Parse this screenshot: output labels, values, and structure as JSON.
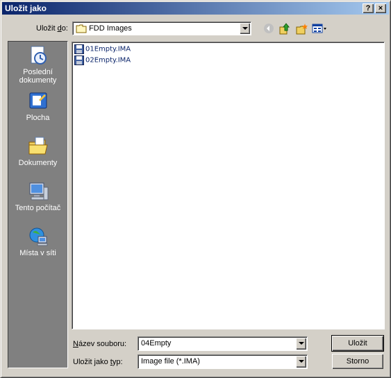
{
  "window": {
    "title": "Uložit jako"
  },
  "titlebar_buttons": {
    "help": "?",
    "close": "×"
  },
  "toolbar": {
    "save_in_label_pre": "Uložit ",
    "save_in_label_key": "d",
    "save_in_label_post": "o:",
    "current_folder": "FDD Images",
    "icons": [
      "back-icon",
      "up-folder-icon",
      "new-folder-icon",
      "view-menu-icon"
    ]
  },
  "places": [
    {
      "label": "Poslední dokumenty",
      "icon": "recent-documents-icon"
    },
    {
      "label": "Plocha",
      "icon": "desktop-icon"
    },
    {
      "label": "Dokumenty",
      "icon": "documents-icon"
    },
    {
      "label": "Tento počítač",
      "icon": "my-computer-icon"
    },
    {
      "label": "Místa v síti",
      "icon": "network-places-icon"
    }
  ],
  "files": [
    {
      "name": "01Empty.IMA"
    },
    {
      "name": "02Empty.IMA"
    }
  ],
  "filename": {
    "label_key": "N",
    "label_rest": "ázev souboru:",
    "value": "04Empty"
  },
  "filetype": {
    "label_pre": "Uložit jako ",
    "label_key": "t",
    "label_post": "yp:",
    "value": "Image file (*.IMA)"
  },
  "buttons": {
    "save": "Uložit",
    "cancel": "Storno"
  }
}
